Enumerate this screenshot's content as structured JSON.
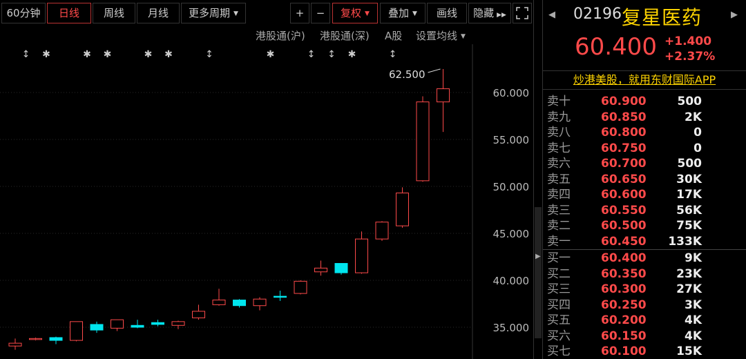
{
  "toolbar": {
    "period_60m": "60分钟",
    "day": "日线",
    "week": "周线",
    "month": "月线",
    "more_periods": "更多周期",
    "zoom_in": "+",
    "zoom_out": "−",
    "adjust": "复权",
    "overlay": "叠加",
    "draw": "画线",
    "hide": "隐藏"
  },
  "subnav": {
    "hk_connect_sh": "港股通(沪)",
    "hk_connect_sz": "港股通(深)",
    "a_share": "A股",
    "ma_settings": "设置均线"
  },
  "colors": {
    "up": "#ff4a4a",
    "down": "#00e5ee",
    "accent": "#ffd400"
  },
  "chart_data": {
    "type": "candlestick",
    "y_ticks": [
      "60.000",
      "55.000",
      "50.000",
      "45.000",
      "40.000",
      "35.000"
    ],
    "ylim": [
      32.4,
      64.9
    ],
    "high_annotation": "62.500",
    "candles": [
      {
        "o": 33.0,
        "c": 33.3,
        "h": 33.8,
        "l": 32.6
      },
      {
        "o": 33.7,
        "c": 33.8,
        "h": 33.9,
        "l": 33.6
      },
      {
        "o": 33.9,
        "c": 33.6,
        "h": 34.0,
        "l": 33.2
      },
      {
        "o": 33.6,
        "c": 35.6,
        "h": 35.6,
        "l": 33.5
      },
      {
        "o": 35.3,
        "c": 34.7,
        "h": 35.6,
        "l": 34.4
      },
      {
        "o": 34.9,
        "c": 35.8,
        "h": 35.8,
        "l": 34.6
      },
      {
        "o": 35.2,
        "c": 35.0,
        "h": 35.8,
        "l": 34.9
      },
      {
        "o": 35.5,
        "c": 35.3,
        "h": 35.8,
        "l": 35.1
      },
      {
        "o": 35.2,
        "c": 35.6,
        "h": 35.7,
        "l": 34.8
      },
      {
        "o": 36.0,
        "c": 36.7,
        "h": 37.4,
        "l": 35.8
      },
      {
        "o": 37.4,
        "c": 37.9,
        "h": 39.1,
        "l": 37.3
      },
      {
        "o": 37.9,
        "c": 37.3,
        "h": 38.0,
        "l": 37.1
      },
      {
        "o": 37.3,
        "c": 38.0,
        "h": 38.2,
        "l": 36.8
      },
      {
        "o": 38.3,
        "c": 38.2,
        "h": 38.9,
        "l": 37.8
      },
      {
        "o": 38.6,
        "c": 39.9,
        "h": 40.0,
        "l": 38.5
      },
      {
        "o": 40.9,
        "c": 41.3,
        "h": 42.1,
        "l": 40.5
      },
      {
        "o": 41.8,
        "c": 40.8,
        "h": 41.8,
        "l": 40.6
      },
      {
        "o": 40.8,
        "c": 44.4,
        "h": 45.2,
        "l": 40.7
      },
      {
        "o": 44.4,
        "c": 46.2,
        "h": 46.3,
        "l": 44.2
      },
      {
        "o": 45.8,
        "c": 49.3,
        "h": 49.9,
        "l": 45.6
      },
      {
        "o": 50.6,
        "c": 59.0,
        "h": 59.6,
        "l": 50.5
      },
      {
        "o": 59.0,
        "c": 60.4,
        "h": 62.5,
        "l": 55.8
      }
    ]
  },
  "quote": {
    "code": "02196",
    "name": "复星医药",
    "price": "60.400",
    "change": "+1.400",
    "change_pct": "+2.37%"
  },
  "ad_text": "炒港美股，就用东财国际APP",
  "order_book": {
    "asks": [
      {
        "label": "卖十",
        "price": "60.900",
        "vol": "500"
      },
      {
        "label": "卖九",
        "price": "60.850",
        "vol": "2K"
      },
      {
        "label": "卖八",
        "price": "60.800",
        "vol": "0"
      },
      {
        "label": "卖七",
        "price": "60.750",
        "vol": "0"
      },
      {
        "label": "卖六",
        "price": "60.700",
        "vol": "500"
      },
      {
        "label": "卖五",
        "price": "60.650",
        "vol": "30K"
      },
      {
        "label": "卖四",
        "price": "60.600",
        "vol": "17K"
      },
      {
        "label": "卖三",
        "price": "60.550",
        "vol": "56K"
      },
      {
        "label": "卖二",
        "price": "60.500",
        "vol": "75K"
      },
      {
        "label": "卖一",
        "price": "60.450",
        "vol": "133K"
      }
    ],
    "bids": [
      {
        "label": "买一",
        "price": "60.400",
        "vol": "9K"
      },
      {
        "label": "买二",
        "price": "60.350",
        "vol": "23K"
      },
      {
        "label": "买三",
        "price": "60.300",
        "vol": "27K"
      },
      {
        "label": "买四",
        "price": "60.250",
        "vol": "3K"
      },
      {
        "label": "买五",
        "price": "60.200",
        "vol": "4K"
      },
      {
        "label": "买六",
        "price": "60.150",
        "vol": "4K"
      },
      {
        "label": "买七",
        "price": "60.100",
        "vol": "15K"
      }
    ]
  },
  "event_markers": [
    "↕",
    "✱",
    "✱",
    "✱",
    "✱",
    "✱",
    "↕",
    "✱",
    "↕",
    "↕",
    "✱",
    "↕"
  ]
}
